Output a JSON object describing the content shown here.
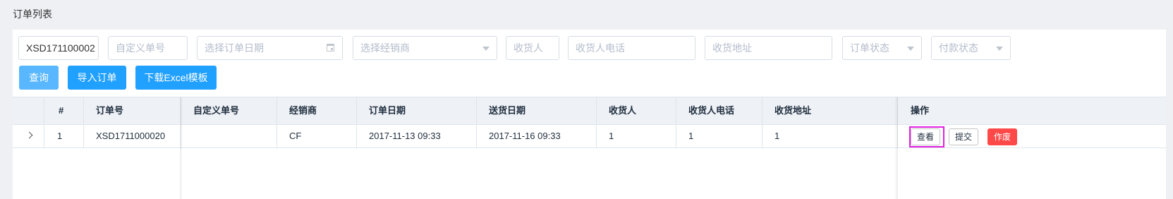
{
  "page": {
    "title": "订单列表"
  },
  "filters": {
    "order_no_value": "XSD171100002",
    "custom_no_placeholder": "自定义单号",
    "order_date_placeholder": "选择订单日期",
    "dealer_placeholder": "选择经销商",
    "receiver_placeholder": "收货人",
    "receiver_phone_placeholder": "收货人电话",
    "receiver_address_placeholder": "收货地址",
    "order_status_placeholder": "订单状态",
    "payment_status_placeholder": "付款状态"
  },
  "actions": {
    "query_label": "查询",
    "import_label": "导入订单",
    "download_label": "下载Excel模板"
  },
  "table": {
    "columns": {
      "index": "#",
      "order_no": "订单号",
      "custom_no": "自定义单号",
      "dealer": "经销商",
      "order_date": "订单日期",
      "delivery_date": "送货日期",
      "receiver": "收货人",
      "receiver_phone": "收货人电话",
      "receiver_address": "收货地址",
      "operation": "操作"
    },
    "rows": [
      {
        "index": "1",
        "order_no": "XSD1711000020",
        "custom_no": "",
        "dealer": "CF",
        "order_date": "2017-11-13 09:33",
        "delivery_date": "2017-11-16 09:33",
        "receiver": "1",
        "receiver_phone": "1",
        "receiver_address": "1",
        "view_label": "查看",
        "submit_label": "提交",
        "void_label": "作废"
      }
    ]
  },
  "icons": {
    "date": "calendar-icon",
    "select": "chevron-down-icon",
    "expand": "chevron-right-icon"
  },
  "colors": {
    "primary": "#20a0ff",
    "query": "#58b7ff",
    "danger": "#ff4949",
    "highlight": "#e020e0"
  }
}
